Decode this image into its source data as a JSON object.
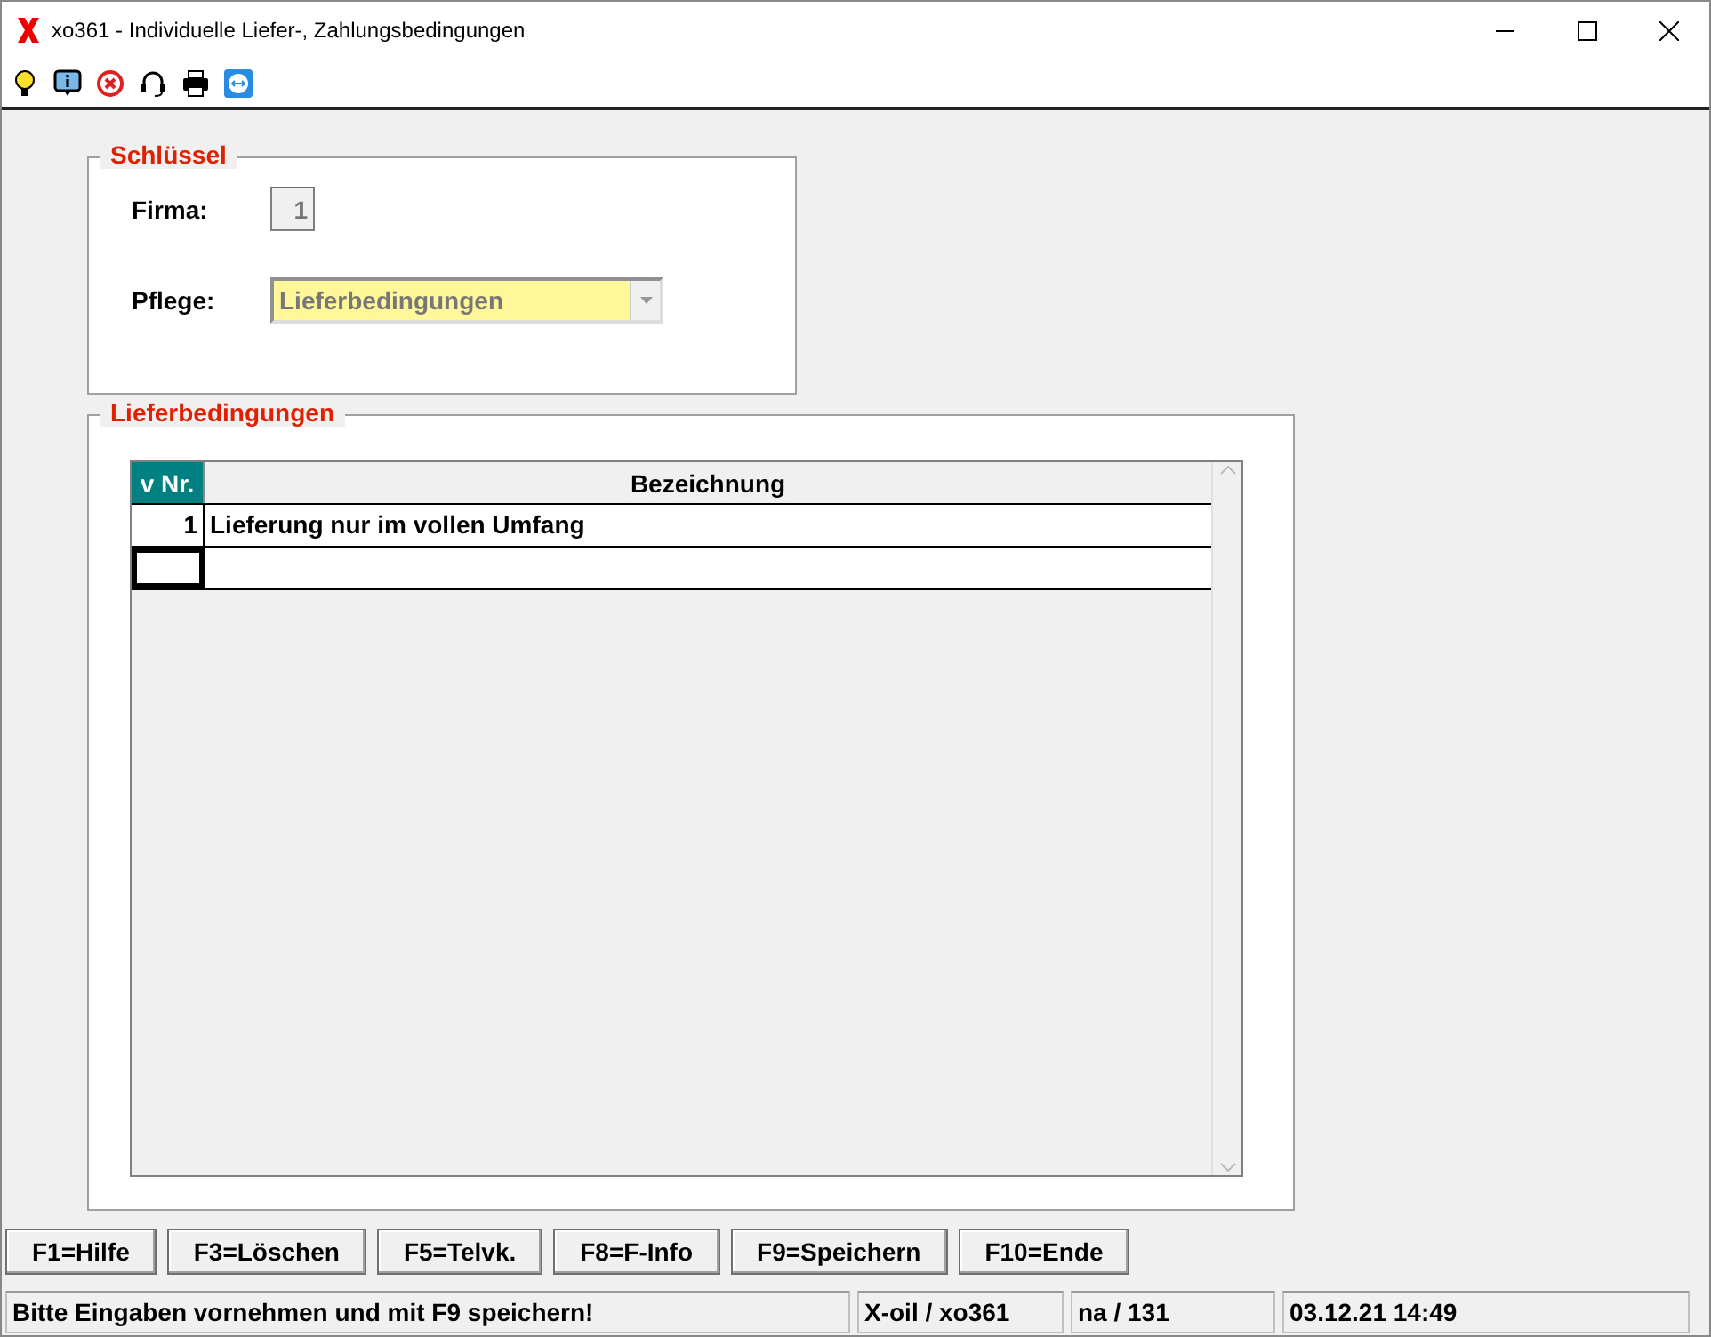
{
  "window": {
    "title": "xo361 - Individuelle Liefer-, Zahlungsbedingungen"
  },
  "schluessel": {
    "legend": "Schlüssel",
    "firma_label": "Firma:",
    "firma_value": "1",
    "pflege_label": "Pflege:",
    "pflege_value": "Lieferbedingungen"
  },
  "liste": {
    "legend": "Lieferbedingungen",
    "columns": [
      "v Nr.",
      "Bezeichnung"
    ],
    "rows": [
      {
        "nr": "1",
        "bezeichnung": "Lieferung nur im vollen Umfang",
        "focused": false
      },
      {
        "nr": "",
        "bezeichnung": "",
        "focused": true
      }
    ]
  },
  "buttons": [
    "F1=Hilfe",
    "F3=Löschen",
    "F5=Telvk.",
    "F8=F-Info",
    "F9=Speichern",
    "F10=Ende"
  ],
  "status_bar": [
    "Bitte Eingaben vornehmen und mit F9 speichern!",
    "X-oil / xo361",
    "na / 131",
    "03.12.21 14:49"
  ]
}
